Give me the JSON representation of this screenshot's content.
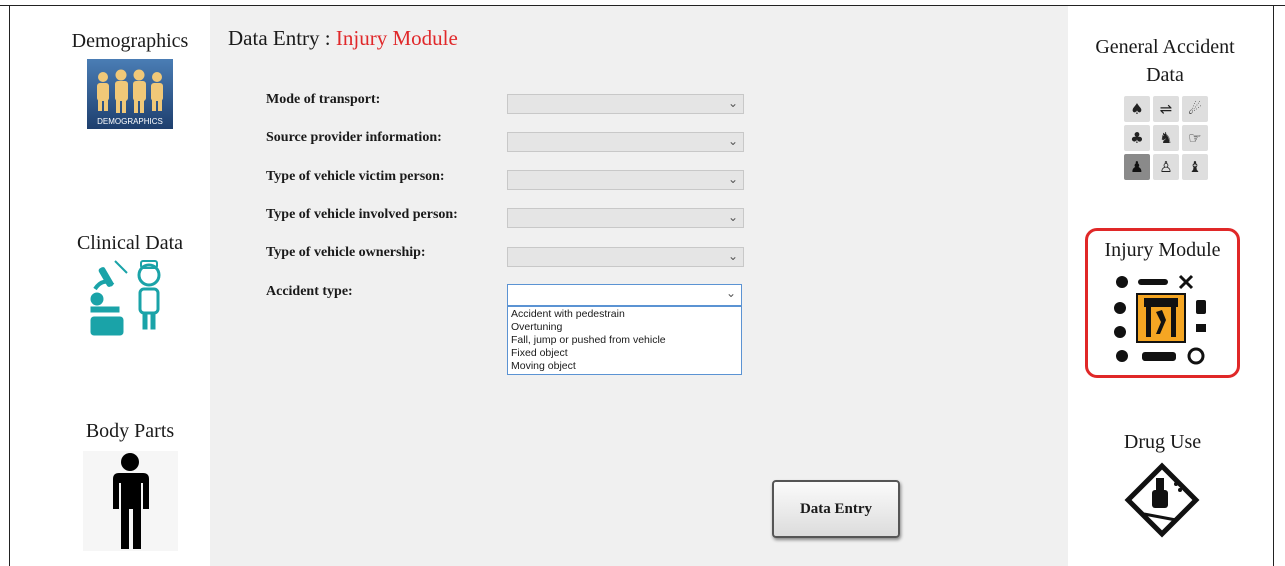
{
  "left_nav": {
    "demographics": {
      "label": "Demographics",
      "tile_text": "DEMOGRAPHICS"
    },
    "clinical": {
      "label": "Clinical Data"
    },
    "body_parts": {
      "label": "Body Parts"
    }
  },
  "header": {
    "prefix": "Data Entry : ",
    "module": "Injury Module"
  },
  "form": {
    "fields": [
      {
        "label": "Mode of transport:"
      },
      {
        "label": "Source provider information:"
      },
      {
        "label": "Type of vehicle victim person:"
      },
      {
        "label": "Type of vehicle involved person:"
      },
      {
        "label": "Type of vehicle ownership:"
      },
      {
        "label": "Accident type:"
      }
    ],
    "accident_type_options": [
      "Accident with pedestrain",
      "Overtuning",
      "Fall, jump or pushed from vehicle",
      "Fixed object",
      "Moving object"
    ],
    "submit_label": "Data Entry"
  },
  "right_nav": {
    "general_accident": {
      "label_line1": "General Accident",
      "label_line2": "Data"
    },
    "injury_module": {
      "label": "Injury Module"
    },
    "drug_use": {
      "label": "Drug Use"
    }
  },
  "colors": {
    "accent_red": "#e02828",
    "teal": "#1aa3a8",
    "orange": "#f5a623"
  }
}
